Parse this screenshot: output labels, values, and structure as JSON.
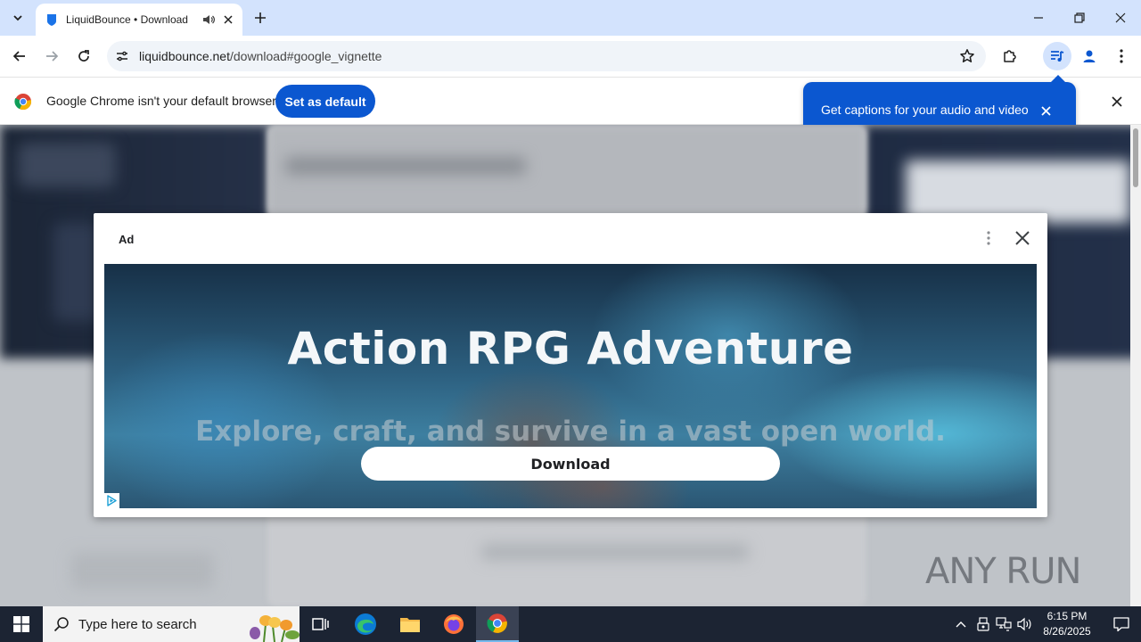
{
  "browser": {
    "tab": {
      "title": "LiquidBounce • Download"
    },
    "url": {
      "domain": "liquidbounce.net",
      "path": "/download#google_vignette"
    }
  },
  "infobar": {
    "message": "Google Chrome isn't your default browser",
    "button": "Set as default"
  },
  "caption_bubble": {
    "text": "Get captions for your audio and video"
  },
  "ad": {
    "label": "Ad",
    "headline": "Action RPG Adventure",
    "subheadline": "Explore, craft, and survive in a vast open world.",
    "cta": "Download"
  },
  "watermark": {
    "text": "ANY RUN"
  },
  "taskbar": {
    "search_placeholder": "Type here to search",
    "time": "6:15 PM",
    "date": "8/26/2025"
  },
  "colors": {
    "accent": "#0b57d0",
    "tabstrip": "#d3e3fd",
    "taskbar": "#1c2433"
  }
}
